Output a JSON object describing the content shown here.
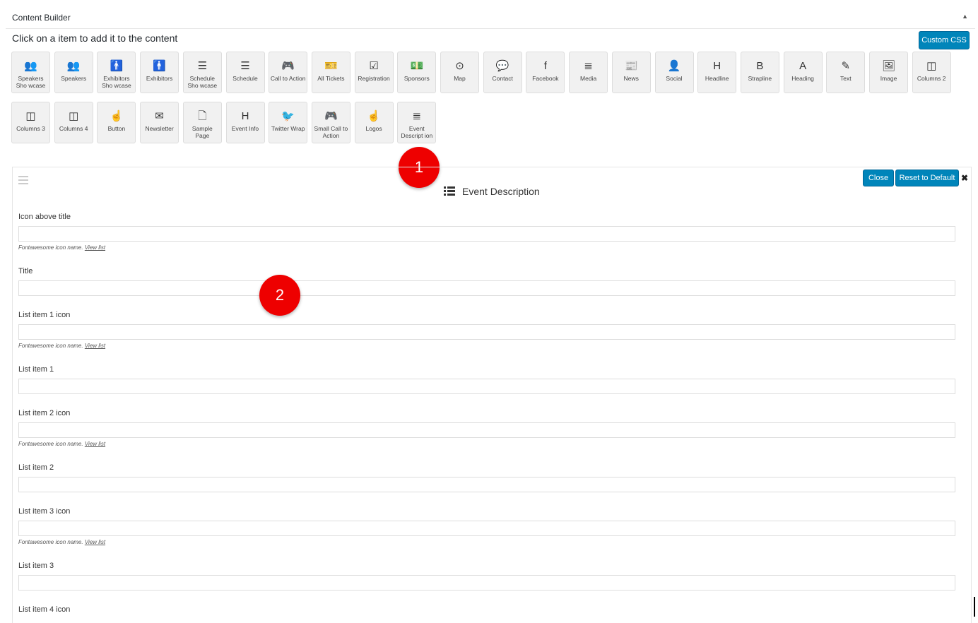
{
  "header": {
    "title": "Content Builder",
    "toggle": "▲"
  },
  "instruction": "Click on a item to add it to the content",
  "custom_css_label": "Custom CSS",
  "tiles": [
    {
      "label": "Speakers Sho wcase",
      "icon": "👥",
      "icon_name": "users-icon"
    },
    {
      "label": "Speakers",
      "icon": "👥",
      "icon_name": "users-icon"
    },
    {
      "label": "Exhibitors Sho wcase",
      "icon": "🚹",
      "icon_name": "male-icon"
    },
    {
      "label": "Exhibitors",
      "icon": "🚹",
      "icon_name": "male-icon"
    },
    {
      "label": "Schedule Sho wcase",
      "icon": "☰",
      "icon_name": "server-icon"
    },
    {
      "label": "Schedule",
      "icon": "☰",
      "icon_name": "server-icon"
    },
    {
      "label": "Call to Action",
      "icon": "🎮",
      "icon_name": "gamepad-icon"
    },
    {
      "label": "All Tickets",
      "icon": "🎫",
      "icon_name": "ticket-icon"
    },
    {
      "label": "Registration",
      "icon": "☑",
      "icon_name": "check-square-icon"
    },
    {
      "label": "Sponsors",
      "icon": "💵",
      "icon_name": "money-icon"
    },
    {
      "label": "Map",
      "icon": "⊙",
      "icon_name": "dot-circle-icon"
    },
    {
      "label": "Contact",
      "icon": "💬",
      "icon_name": "comment-icon"
    },
    {
      "label": "Facebook",
      "icon": "f",
      "icon_name": "facebook-icon"
    },
    {
      "label": "Media",
      "icon": "≣",
      "icon_name": "list-icon"
    },
    {
      "label": "News",
      "icon": "📰",
      "icon_name": "newspaper-icon"
    },
    {
      "label": "Social",
      "icon": "👤",
      "icon_name": "user-plus-icon"
    },
    {
      "label": "Headline",
      "icon": "H",
      "icon_name": "header-icon"
    },
    {
      "label": "Strapline",
      "icon": "B",
      "icon_name": "bold-icon"
    },
    {
      "label": "Heading",
      "icon": "A",
      "icon_name": "font-icon"
    },
    {
      "label": "Text",
      "icon": "✎",
      "icon_name": "pencil-icon"
    },
    {
      "label": "Image",
      "icon": "🖼",
      "icon_name": "image-icon"
    },
    {
      "label": "Columns 2",
      "icon": "◫",
      "icon_name": "columns-icon"
    },
    {
      "label": "Columns 3",
      "icon": "◫",
      "icon_name": "columns-icon"
    },
    {
      "label": "Columns 4",
      "icon": "◫",
      "icon_name": "columns-icon"
    },
    {
      "label": "Button",
      "icon": "☝",
      "icon_name": "hand-pointer-icon"
    },
    {
      "label": "Newsletter",
      "icon": "✉",
      "icon_name": "envelope-icon"
    },
    {
      "label": "Sample Page",
      "icon": "🗋",
      "icon_name": "file-icon"
    },
    {
      "label": "Event Info",
      "icon": "H",
      "icon_name": "header-icon"
    },
    {
      "label": "Twitter Wrap",
      "icon": "🐦",
      "icon_name": "twitter-icon"
    },
    {
      "label": "Small Call to Action",
      "icon": "🎮",
      "icon_name": "gamepad-icon"
    },
    {
      "label": "Logos",
      "icon": "☝",
      "icon_name": "hand-pointer-icon"
    },
    {
      "label": "Event Descript ion",
      "icon": "≣",
      "icon_name": "list-icon"
    }
  ],
  "markers": [
    "1",
    "2"
  ],
  "panel": {
    "title": "Event Description",
    "close_label": "Close",
    "reset_label": "Reset to Default",
    "close_x": "✖"
  },
  "help_text": "Fontawesome icon name.",
  "help_link": "View list",
  "fields": [
    {
      "label": "Icon above title",
      "help": true
    },
    {
      "label": "Title",
      "help": false
    },
    {
      "label": "List item 1 icon",
      "help": true
    },
    {
      "label": "List item 1",
      "help": false
    },
    {
      "label": "List item 2 icon",
      "help": true
    },
    {
      "label": "List item 2",
      "help": false
    },
    {
      "label": "List item 3 icon",
      "help": true
    },
    {
      "label": "List item 3",
      "help": false
    },
    {
      "label": "List item 4 icon",
      "help": false
    }
  ],
  "colors": {
    "accent": "#0085ba",
    "marker": "#e00000"
  }
}
